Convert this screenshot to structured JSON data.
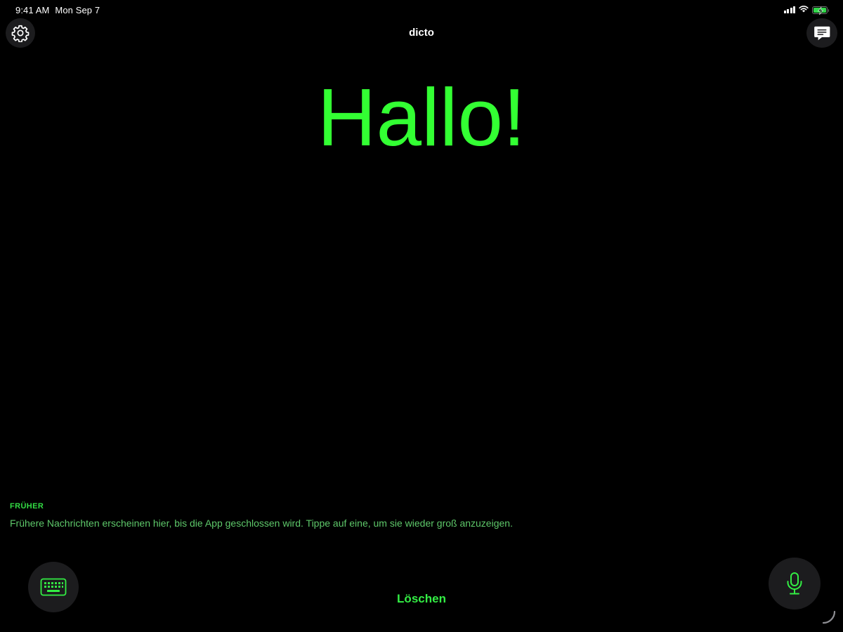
{
  "status_bar": {
    "time": "9:41 AM",
    "date": "Mon Sep 7",
    "icons": [
      "signal-icon",
      "wifi-icon",
      "battery-charging-icon"
    ]
  },
  "nav": {
    "title": "dicto",
    "left_icon": "gear-icon",
    "right_icon": "chat-bubble-icon"
  },
  "main": {
    "message": "Hallo!"
  },
  "history": {
    "header": "FRÜHER",
    "hint": "Frühere Nachrichten erscheinen hier, bis die App geschlossen wird. Tippe auf eine, um sie wieder groß anzuzeigen."
  },
  "controls": {
    "clear_label": "Löschen",
    "keyboard_icon": "keyboard-icon",
    "mic_icon": "microphone-icon"
  },
  "colors": {
    "background": "#000000",
    "accent": "#33ff33",
    "button_bg": "#1c1c1e"
  }
}
